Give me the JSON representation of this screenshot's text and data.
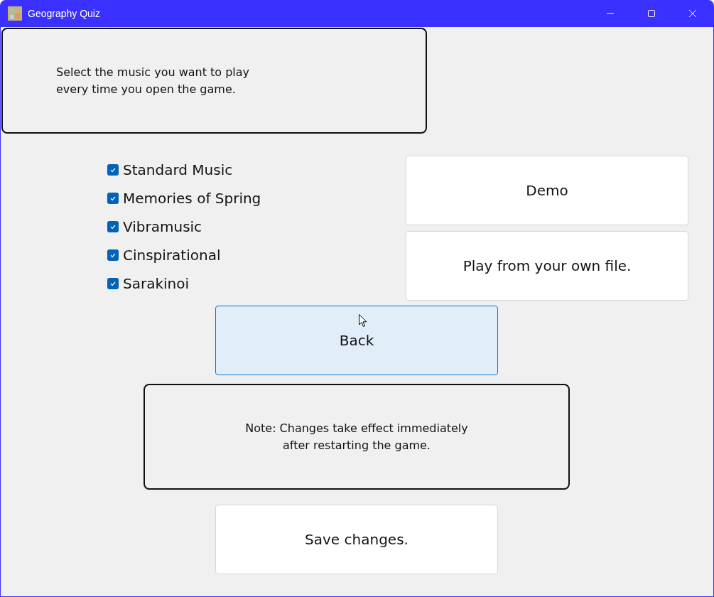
{
  "window": {
    "title": "Geography Quiz"
  },
  "intro": {
    "text": "Select the music you want to play\nevery time you open the game."
  },
  "music_options": [
    {
      "label": "Standard Music",
      "checked": true
    },
    {
      "label": "Memories of Spring",
      "checked": true
    },
    {
      "label": "Vibramusic",
      "checked": true
    },
    {
      "label": "Cinspirational",
      "checked": true
    },
    {
      "label": "Sarakinoi",
      "checked": true
    }
  ],
  "side_buttons": [
    {
      "label": "Demo",
      "hovered": false
    },
    {
      "label": "Play from your own file.",
      "hovered": false
    }
  ],
  "back_button": {
    "label": "Back",
    "hovered": true
  },
  "note": {
    "text": "Note: Changes take effect immediately\nafter restarting the game."
  },
  "save_button": {
    "label": "Save changes.",
    "hovered": false
  }
}
